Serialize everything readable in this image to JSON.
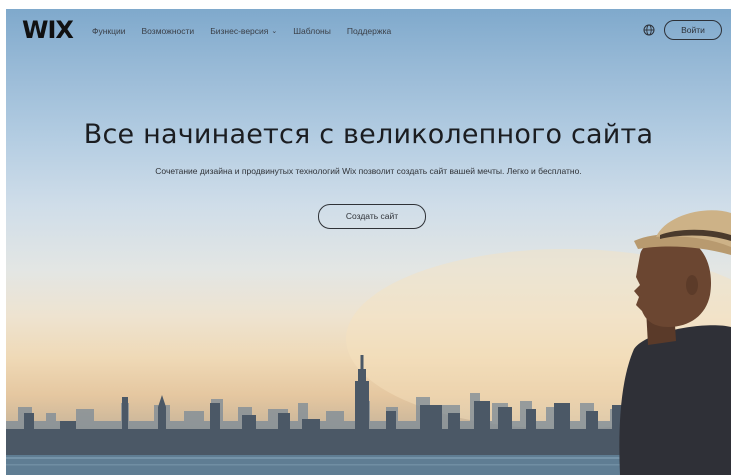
{
  "header": {
    "logo": "WIX",
    "nav": [
      {
        "label": "Функции"
      },
      {
        "label": "Возможности"
      },
      {
        "label": "Бизнес-версия"
      },
      {
        "label": "Шаблоны"
      },
      {
        "label": "Поддержка"
      }
    ],
    "login_label": "Войти"
  },
  "hero": {
    "title": "Все начинается с великолепного сайта",
    "subtitle": "Сочетание дизайна и продвинутых технологий Wix позволит создать сайт вашей мечты. Легко и бесплатно.",
    "cta_label": "Создать сайт"
  }
}
